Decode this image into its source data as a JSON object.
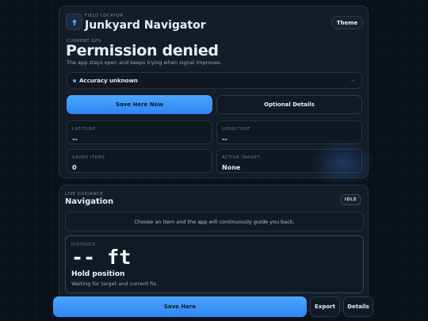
{
  "header": {
    "eyebrow": "FIELD LOCATOR",
    "title": "Junkyard Navigator",
    "theme_label": "Theme"
  },
  "gps": {
    "eyebrow": "CURRENT GPS",
    "status": "Permission denied",
    "subtitle": "The app stays open and keeps trying when signal improves.",
    "accuracy_label": "Accuracy unknown",
    "accuracy_value": "--"
  },
  "actions": {
    "save_here_now": "Save Here Now",
    "optional_details": "Optional Details"
  },
  "stats": [
    {
      "label": "LATITUDE",
      "value": "--"
    },
    {
      "label": "LONGITUDE",
      "value": "--"
    },
    {
      "label": "SAVED ITEMS",
      "value": "0"
    },
    {
      "label": "ACTIVE TARGET",
      "value": "None"
    }
  ],
  "guidance": {
    "eyebrow": "LIVE GUIDANCE",
    "title": "Navigation",
    "state_badge": "IDLE",
    "hint": "Choose an item and the app will continuously guide you back.",
    "distance_label": "DISTANCE",
    "distance_value": "-- ft",
    "direction": "Hold position",
    "direction_sub": "Waiting for target and current fix."
  },
  "bottom": {
    "save_here": "Save Here",
    "export": "Export",
    "details": "Details"
  },
  "colors": {
    "accent": "#3f9bff",
    "status_dot": "#4aa6ff",
    "background": "#0b1119",
    "card": "#131c27"
  }
}
